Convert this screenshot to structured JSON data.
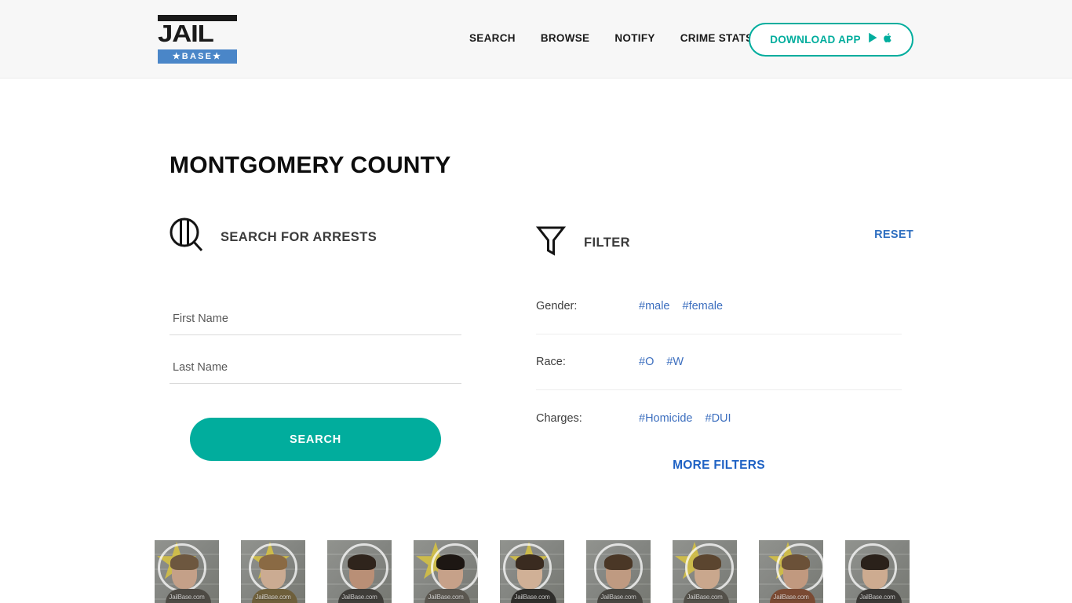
{
  "header": {
    "logo": {
      "top_word": "JAIL",
      "bottom_word": "★BASE★",
      "bottom_bg": "#4a86c8"
    },
    "nav": [
      {
        "label": "SEARCH",
        "name": "nav-search"
      },
      {
        "label": "BROWSE",
        "name": "nav-browse"
      },
      {
        "label": "NOTIFY",
        "name": "nav-notify"
      },
      {
        "label": "CRIME STATS",
        "name": "nav-crime-stats"
      }
    ],
    "download_button": {
      "label": "DOWNLOAD APP",
      "icons": [
        "google-play-icon",
        "apple-icon"
      ],
      "accent": "#01ad9d"
    }
  },
  "main": {
    "page_title": "MONTGOMERY COUNTY",
    "search": {
      "icon": "mugshot-search-icon",
      "heading": "SEARCH FOR ARRESTS",
      "first_name": {
        "value": "",
        "placeholder": "First Name"
      },
      "last_name": {
        "value": "",
        "placeholder": "Last Name"
      },
      "submit_label": "SEARCH",
      "submit_color": "#01ad9d"
    },
    "filter": {
      "icon": "funnel-icon",
      "heading": "FILTER",
      "reset_label": "RESET",
      "more_filters_label": "MORE FILTERS",
      "link_color": "#3d6fbf",
      "rows": [
        {
          "label": "Gender:",
          "tags": [
            "#male",
            "#female"
          ]
        },
        {
          "label": "Race:",
          "tags": [
            "#O",
            "#W"
          ]
        },
        {
          "label": "Charges:",
          "tags": [
            "#Homicide",
            "#DUI"
          ]
        }
      ]
    },
    "mugshots": {
      "watermark": "JailBase.com",
      "count": 9
    }
  }
}
